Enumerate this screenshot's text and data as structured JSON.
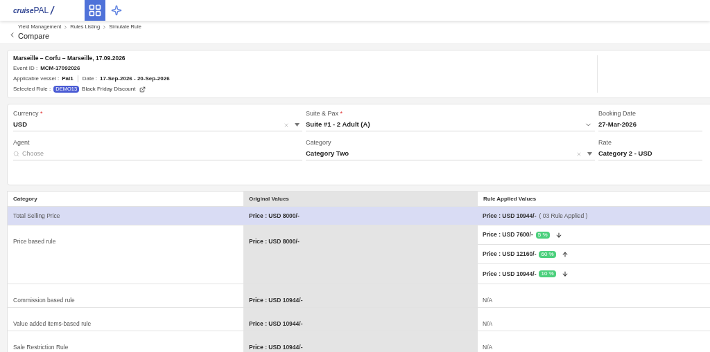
{
  "header": {
    "logo": {
      "part_a": "cruise",
      "part_b": "PAL"
    },
    "nav": [
      {
        "kind": "apps",
        "selected": true
      },
      {
        "kind": "star",
        "selected": false
      }
    ]
  },
  "breadcrumb": [
    "Yield Management",
    "Rules Listing",
    "Simulate Rule"
  ],
  "page_title": "Compare",
  "event": {
    "title": "Marseille – Corfu – Marseille, 17.09.2026",
    "event_id_label": "Event ID :",
    "event_id": "MCM-17092026",
    "vessel_label": "Applicable vessel :",
    "vessel": "Pal1",
    "date_label": "Date :",
    "date": "17-Sep-2026 - 20-Sep-2026",
    "rule_label": "Selected Rule :",
    "rule_badge": "DEMO13",
    "rule_name": "Black Friday Discount"
  },
  "form": [
    {
      "kind": "select",
      "label": "Currency",
      "required_mark": "*",
      "value": "USD",
      "clear": true
    },
    {
      "kind": "dropdown",
      "label": "Suite & Pax",
      "required_mark": "*",
      "value": "Suite #1 - 2 Adult (A)",
      "clear": false
    },
    {
      "kind": "text",
      "label": "Booking Date",
      "value": "27-Mar-2026",
      "clear": false
    },
    {
      "kind": "search",
      "label": "Agent",
      "placeholder": "Choose",
      "clear": false
    },
    {
      "kind": "select",
      "label": "Category",
      "value": "Category Two",
      "clear": true
    },
    {
      "kind": "text",
      "label": "Rate",
      "value": "Category 2 - USD",
      "clear": false
    }
  ],
  "table": {
    "columns": [
      "Category",
      "Original Values",
      "Rule Applied Values"
    ],
    "rows": [
      {
        "category": "Total Selling Price",
        "original": "Price : USD 8000/-",
        "highlighted": true,
        "applied": [
          {
            "kind": "plain",
            "price": "Price : USD 10944/-",
            "note": "( 03 Rule Applied )"
          }
        ]
      },
      {
        "category": "Price based rule",
        "original": "Price : USD 8000/-",
        "highlighted": false,
        "applied": [
          {
            "kind": "down",
            "price": "Price : USD 7600/-",
            "badge": "5 %"
          },
          {
            "kind": "up",
            "price": "Price : USD 12160/-",
            "badge": "60 %"
          },
          {
            "kind": "down",
            "price": "Price : USD 10944/-",
            "badge": "10 %"
          }
        ]
      },
      {
        "category": "Commission based rule",
        "original": "Price : USD 10944/-",
        "highlighted": false,
        "applied": [
          {
            "kind": "na",
            "text": "N/A"
          }
        ]
      },
      {
        "category": "Value added items-based rule",
        "original": "Price : USD 10944/-",
        "highlighted": false,
        "applied": [
          {
            "kind": "na",
            "text": "N/A"
          }
        ]
      },
      {
        "category": "Sale Restriction Rule",
        "original": "Price : USD 10944/-",
        "highlighted": false,
        "applied": [
          {
            "kind": "na",
            "text": "N/A"
          }
        ]
      }
    ]
  }
}
